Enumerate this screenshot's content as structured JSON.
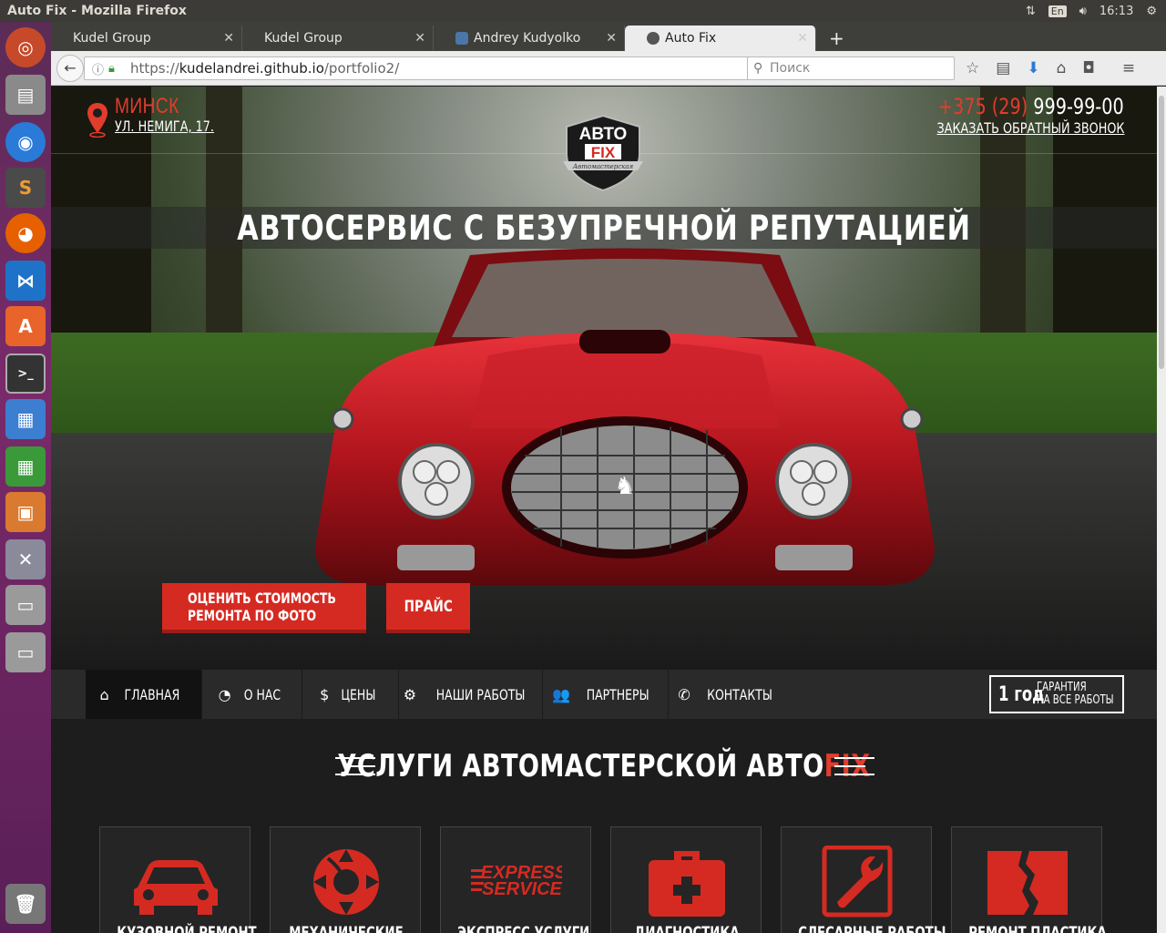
{
  "os": {
    "window_title": "Auto Fix - Mozilla Firefox",
    "keyboard_layout": "En",
    "clock": "16:13"
  },
  "browser": {
    "tabs": [
      {
        "label": "Kudel Group",
        "active": false
      },
      {
        "label": "Kudel Group",
        "active": false
      },
      {
        "label": "Andrey Kudyolko",
        "active": false
      },
      {
        "label": "Auto Fix",
        "active": true
      }
    ],
    "url_scheme": "https://",
    "url_host": "kudelandrei.github.io",
    "url_path": "/portfolio2/",
    "search_placeholder": "Поиск"
  },
  "site": {
    "city": "МИНСК",
    "address": "УЛ. НЕМИГА, 17.",
    "phone_code": "+375 (29)",
    "phone_number": "999-99-00",
    "callback": "ЗАКАЗАТЬ ОБРАТНЫЙ ЗВОНОК",
    "logo_top": "АВТО",
    "logo_main": "FIX",
    "logo_ribbon": "Автомастерская",
    "headline": "АВТОСЕРВИС С БЕЗУПРЕЧНОЙ РЕПУТАЦИЕЙ",
    "btn_estimate_line1": "ОЦЕНИТЬ СТОИМОСТЬ",
    "btn_estimate_line2": "РЕМОНТА ПО ФОТО",
    "btn_price": "ПРАЙС",
    "menu": [
      {
        "label": "ГЛАВНАЯ",
        "icon": "home-icon",
        "glyph": "⌂"
      },
      {
        "label": "О НАС",
        "icon": "dashboard-icon",
        "glyph": "◔"
      },
      {
        "label": "ЦЕНЫ",
        "icon": "dollar-icon",
        "glyph": "$"
      },
      {
        "label": "НАШИ РАБОТЫ",
        "icon": "gears-icon",
        "glyph": "⚙"
      },
      {
        "label": "ПАРТНЕРЫ",
        "icon": "users-icon",
        "glyph": "👥"
      },
      {
        "label": "КОНТАКТЫ",
        "icon": "phone-icon",
        "glyph": "✆"
      }
    ],
    "guarantee_big": "1 год",
    "guarantee_line1": "ГАРАНТИЯ",
    "guarantee_line2": "НА ВСЕ РАБОТЫ",
    "services_title": "УСЛУГИ АВТОМАСТЕРСКОЙ АВТО",
    "services_title_accent": "FIX",
    "services": [
      {
        "label": "КУЗОВНОЙ РЕМОНТ",
        "icon": "car-icon"
      },
      {
        "label": "МЕХАНИЧЕСКИЕ",
        "icon": "brake-disc-icon"
      },
      {
        "label": "ЭКСПРЕСС УСЛУГИ",
        "icon": "express-service-icon"
      },
      {
        "label": "ДИАГНОСТИКА",
        "icon": "first-aid-icon"
      },
      {
        "label": "СЛЕСАРНЫЕ РАБОТЫ",
        "icon": "wrench-icon"
      },
      {
        "label": "РЕМОНТ ПЛАСТИКА",
        "icon": "cracked-plastic-icon"
      }
    ],
    "express_text1": "EXPRESS",
    "express_text2": "SERVICE",
    "accent": "#e23c2c"
  }
}
